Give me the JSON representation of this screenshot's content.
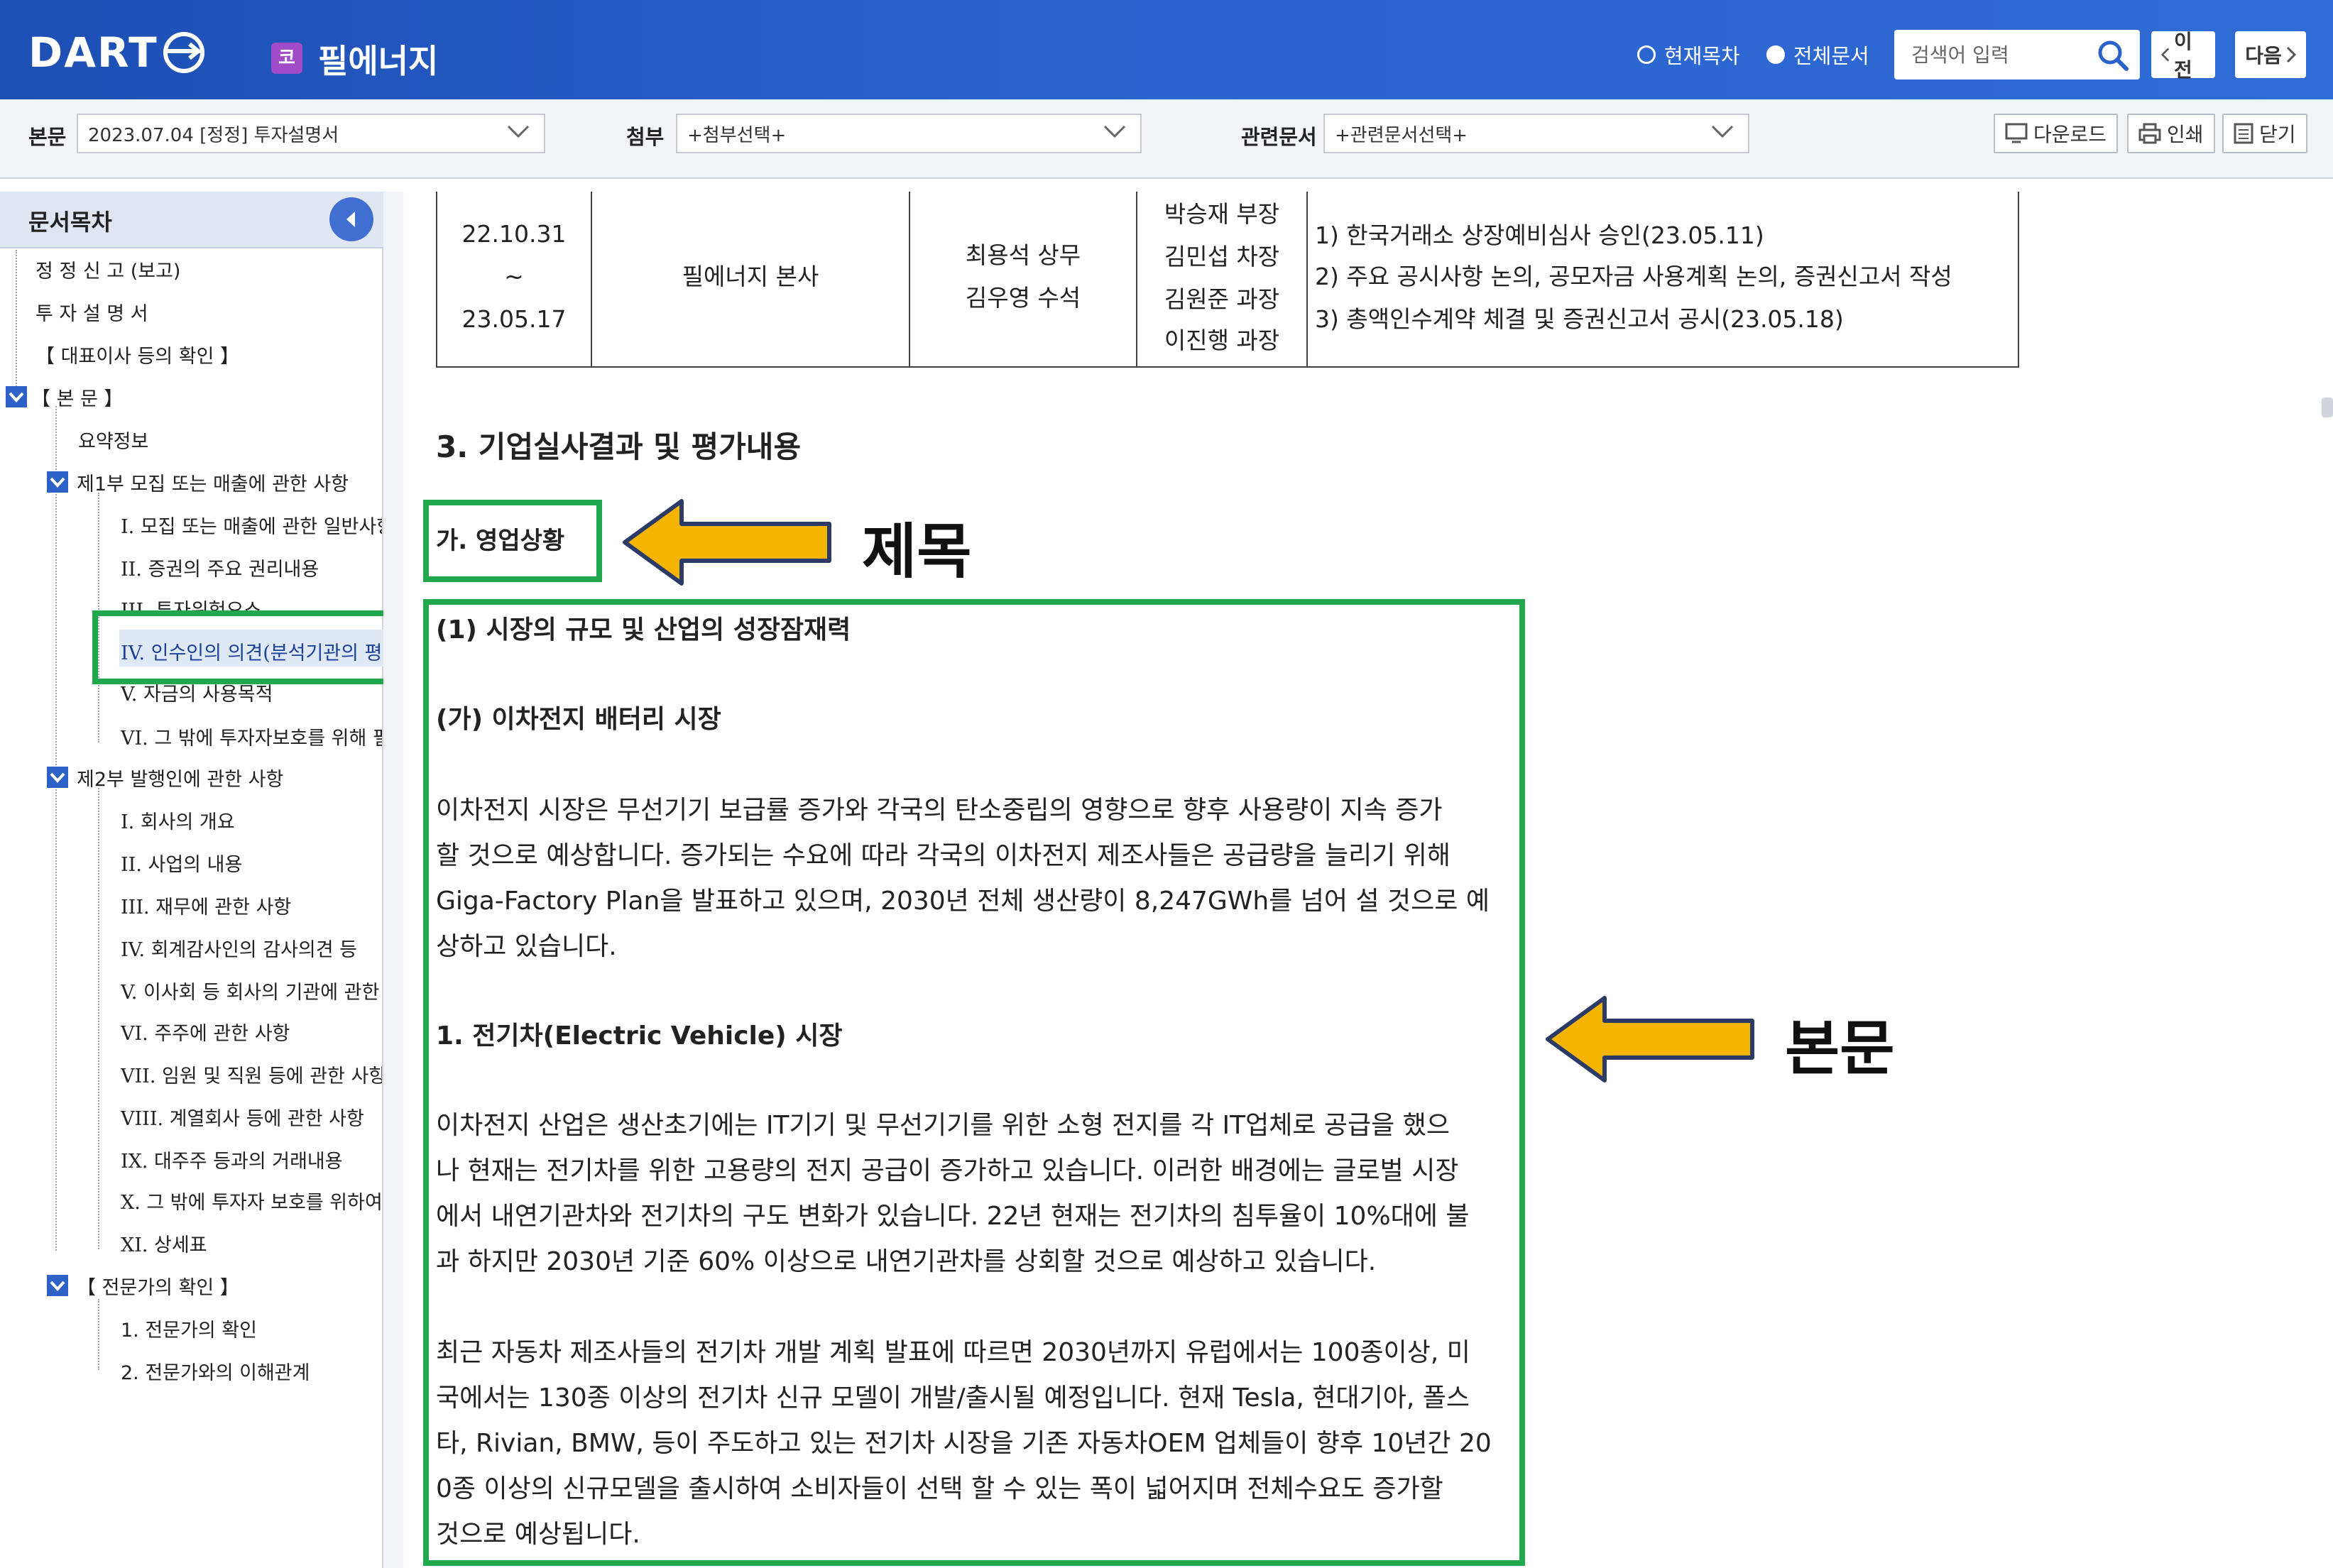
{
  "header": {
    "logo": "DART",
    "company_badge": "코",
    "company_name": "필에너지",
    "radio_current": "현재목차",
    "radio_all": "전체문서",
    "search_placeholder": "검색어 입력",
    "prev_label": "이전",
    "next_label": "다음"
  },
  "toolbar": {
    "main_label": "본문",
    "main_value": "2023.07.04  [정정] 투자설명서",
    "attach_label": "첨부",
    "attach_value": "+첨부선택+",
    "related_label": "관련문서",
    "related_value": "+관련문서선택+",
    "download_label": "다운로드",
    "print_label": "인쇄",
    "close_label": "닫기"
  },
  "sidebar": {
    "title": "문서목차",
    "items": [
      "정 정 신 고 (보고)",
      "투 자 설 명 서",
      "【 대표이사 등의 확인 】",
      "【 본 문 】",
      "요약정보",
      "제1부 모집 또는 매출에 관한 사항",
      "I. 모집 또는 매출에 관한 일반사항",
      "II. 증권의 주요 권리내용",
      "III. 투자위험요소",
      "IV. 인수인의 의견(분석기관의 평가의견)",
      "V. 자금의 사용목적",
      "VI. 그 밖에 투자자보호를 위해 필요한 사항",
      "제2부 발행인에 관한 사항",
      "I. 회사의 개요",
      "II. 사업의 내용",
      "III. 재무에 관한 사항",
      "IV. 회계감사인의 감사의견 등",
      "V. 이사회 등 회사의 기관에 관한 사항",
      "VI. 주주에 관한 사항",
      "VII. 임원 및 직원 등에 관한 사항",
      "VIII. 계열회사 등에 관한 사항",
      "IX. 대주주 등과의 거래내용",
      "X. 그 밖에 투자자 보호를 위하여 필요한 사항",
      "XI. 상세표",
      "【 전문가의 확인 】",
      "1. 전문가의 확인",
      "2. 전문가와의 이해관계"
    ]
  },
  "table_row": {
    "date_start": "22.10.31",
    "date_sep": "~",
    "date_end": "23.05.17",
    "location": "필에너지 본사",
    "staff_1": "최용석 상무",
    "staff_2": "김우영 수석",
    "counterpart_1": "박승재 부장",
    "counterpart_2": "김민섭 차장",
    "counterpart_3": "김원준 과장",
    "counterpart_4": "이진행 과장",
    "content_1": "1) 한국거래소 상장예비심사 승인(23.05.11)",
    "content_2": "2) 주요 공시사항 논의, 공모자금 사용계획 논의, 증권신고서 작성",
    "content_3": "3) 총액인수계약 체결 및 증권신고서 공시(23.05.18)"
  },
  "content": {
    "section_title": "3. 기업실사결과 및 평가내용",
    "subsection_title": "가. 영업상황",
    "heading_1": "(1) 시장의 규모 및 산업의 성장잠재력",
    "heading_2": "(가) 이차전지 배터리 시장",
    "para_1": [
      "이차전지 시장은 무선기기 보급률 증가와 각국의 탄소중립의 영향으로 향후 사용량이 지속 증가",
      "할 것으로 예상합니다. 증가되는 수요에 따라 각국의 이차전지 제조사들은 공급량을 늘리기 위해",
      "Giga-Factory Plan을 발표하고 있으며, 2030년 전체 생산량이 8,247GWh를 넘어 설 것으로 예",
      "상하고 있습니다."
    ],
    "heading_3": "1. 전기차(Electric Vehicle) 시장",
    "para_2": [
      "이차전지 산업은 생산초기에는 IT기기 및 무선기기를 위한 소형 전지를 각 IT업체로 공급을 했으",
      "나 현재는 전기차를 위한 고용량의 전지 공급이 증가하고 있습니다. 이러한 배경에는 글로벌 시장",
      "에서 내연기관차와 전기차의 구도 변화가 있습니다. 22년 현재는 전기차의 침투율이 10%대에 불",
      "과 하지만 2030년 기준 60% 이상으로 내연기관차를 상회할 것으로 예상하고 있습니다."
    ],
    "para_3": [
      "최근 자동차 제조사들의 전기차 개발 계획 발표에 따르면 2030년까지 유럽에서는 100종이상, 미",
      "국에서는 130종 이상의 전기차 신규 모델이 개발/출시될 예정입니다. 현재 Tesla, 현대기아, 폴스",
      "타, Rivian, BMW, 등이 주도하고 있는 전기차 시장을 기존 자동차OEM 업체들이 향후 10년간 20",
      "0종 이상의 신규모델을 출시하여 소비자들이 선택 할 수 있는 폭이 넓어지며 전체수요도 증가할",
      "것으로 예상됩니다."
    ]
  },
  "annotations": {
    "title_label": "제목",
    "body_label": "본문"
  },
  "colors": {
    "header_blue": "#2a62cc",
    "highlight_green": "#21a84d",
    "arrow_yellow": "#f5b400"
  }
}
